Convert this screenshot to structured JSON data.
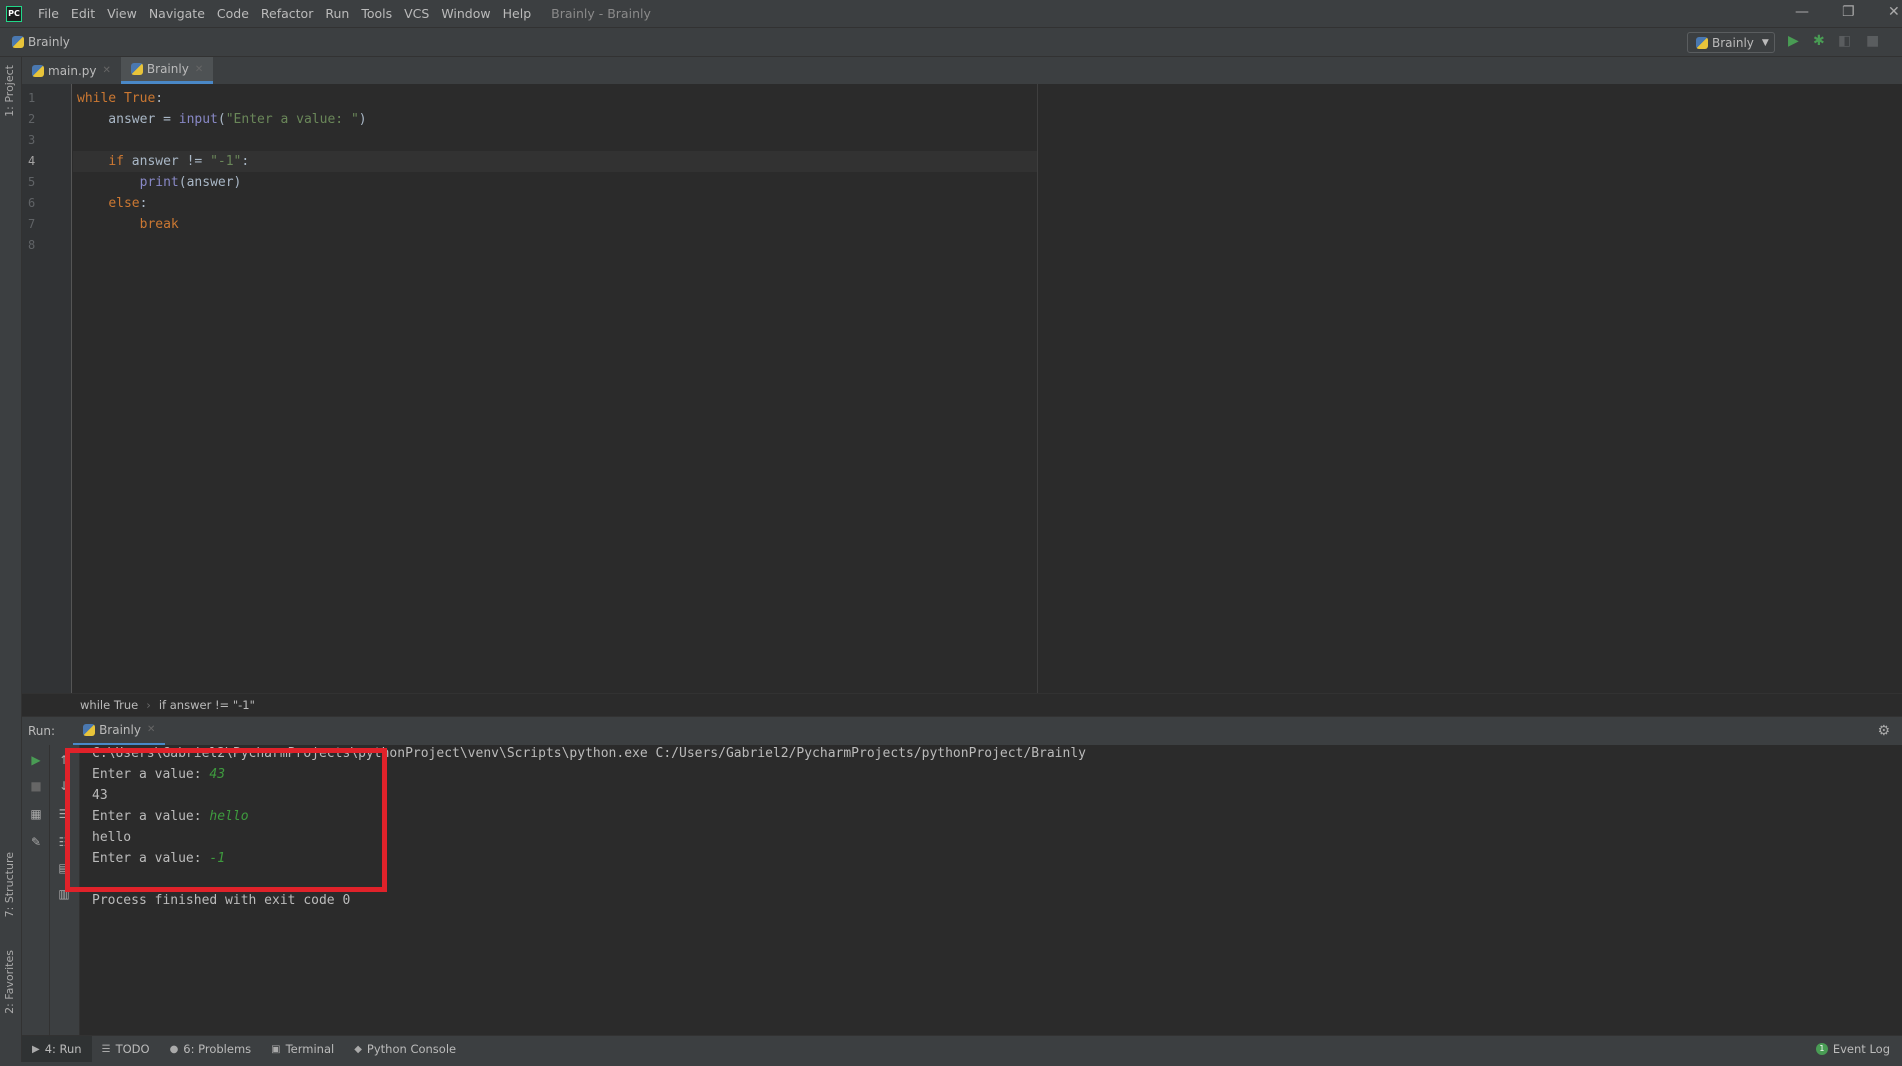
{
  "menubar": {
    "logo": "PC",
    "items": [
      "File",
      "Edit",
      "View",
      "Navigate",
      "Code",
      "Refactor",
      "Run",
      "Tools",
      "VCS",
      "Window",
      "Help"
    ],
    "title": "Brainly - Brainly"
  },
  "toolbar": {
    "project": "Brainly",
    "run_config": "Brainly"
  },
  "tabs": [
    {
      "label": "main.py",
      "active": false
    },
    {
      "label": "Brainly",
      "active": true
    }
  ],
  "side_labels": {
    "project": "1: Project",
    "structure": "7: Structure",
    "favorites": "2: Favorites"
  },
  "editor": {
    "line_numbers": [
      "1",
      "2",
      "3",
      "4",
      "5",
      "6",
      "7",
      "8"
    ],
    "lines": [
      [
        {
          "t": "while",
          "c": "kw"
        },
        {
          "t": " "
        },
        {
          "t": "True",
          "c": "kw"
        },
        {
          "t": ":"
        }
      ],
      [
        {
          "t": "    answer = "
        },
        {
          "t": "input",
          "c": "bi"
        },
        {
          "t": "("
        },
        {
          "t": "\"Enter a value: \"",
          "c": "str"
        },
        {
          "t": ")"
        }
      ],
      [],
      [
        {
          "t": "    "
        },
        {
          "t": "if",
          "c": "kw"
        },
        {
          "t": " answer != "
        },
        {
          "t": "\"-1\"",
          "c": "str"
        },
        {
          "t": ":"
        }
      ],
      [
        {
          "t": "        "
        },
        {
          "t": "print",
          "c": "bi"
        },
        {
          "t": "(answer)"
        }
      ],
      [
        {
          "t": "    "
        },
        {
          "t": "else",
          "c": "kw"
        },
        {
          "t": ":"
        }
      ],
      [
        {
          "t": "        "
        },
        {
          "t": "break",
          "c": "kw"
        }
      ],
      []
    ]
  },
  "breadcrumb": [
    "while True",
    "if answer != \"-1\""
  ],
  "run": {
    "label": "Run:",
    "tab": "Brainly",
    "output": [
      {
        "text": "C:\\Users\\Gabriel2\\PycharmProjects\\pythonProject\\venv\\Scripts\\python.exe C:/Users/Gabriel2/PycharmProjects/pythonProject/Brainly",
        "input": ""
      },
      {
        "text": "Enter a value: ",
        "input": "43"
      },
      {
        "text": "43",
        "input": ""
      },
      {
        "text": "Enter a value: ",
        "input": "hello"
      },
      {
        "text": "hello",
        "input": ""
      },
      {
        "text": "Enter a value: ",
        "input": "-1"
      },
      {
        "text": "",
        "input": ""
      },
      {
        "text": "Process finished with exit code 0",
        "input": ""
      }
    ]
  },
  "bottom_tabs": [
    {
      "label": "4: Run",
      "icon": "▶"
    },
    {
      "label": "TODO",
      "icon": "☰"
    },
    {
      "label": "6: Problems",
      "icon": "●"
    },
    {
      "label": "Terminal",
      "icon": "▣"
    },
    {
      "label": "Python Console",
      "icon": "◆"
    }
  ],
  "event_log": {
    "label": "Event Log",
    "count": "1"
  },
  "colors": {
    "accent": "#4a88c7",
    "highlight_box": "#e0222a",
    "run_green": "#499c54"
  }
}
